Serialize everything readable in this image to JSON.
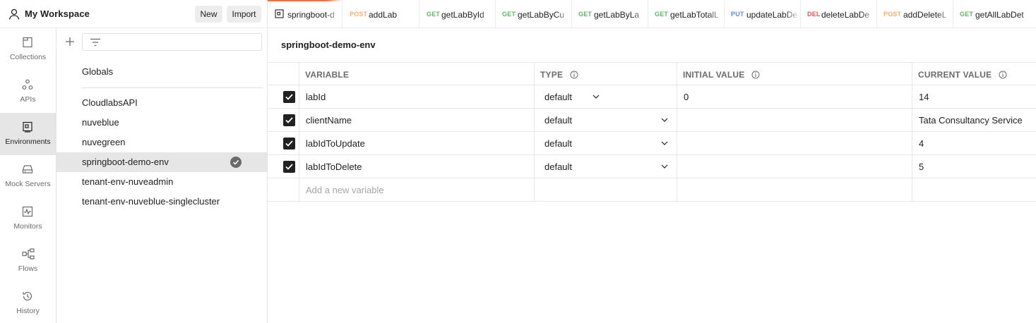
{
  "workspace": {
    "title": "My Workspace",
    "new_label": "New",
    "import_label": "Import"
  },
  "rail": [
    {
      "label": "Collections",
      "icon": "collections-icon"
    },
    {
      "label": "APIs",
      "icon": "apis-icon"
    },
    {
      "label": "Environments",
      "icon": "environments-icon",
      "active": true
    },
    {
      "label": "Mock Servers",
      "icon": "mock-servers-icon"
    },
    {
      "label": "Monitors",
      "icon": "monitors-icon"
    },
    {
      "label": "Flows",
      "icon": "flows-icon"
    },
    {
      "label": "History",
      "icon": "history-icon"
    }
  ],
  "env_list": {
    "globals": "Globals",
    "items": [
      {
        "label": "CloudlabsAPI"
      },
      {
        "label": "nuveblue"
      },
      {
        "label": "nuvegreen"
      },
      {
        "label": "springboot-demo-env",
        "active": true
      },
      {
        "label": "tenant-env-nuveadmin"
      },
      {
        "label": "tenant-env-nuveblue-singlecluster"
      }
    ]
  },
  "tabs": [
    {
      "method": "",
      "name": "springboot-d"
    },
    {
      "method": "POST",
      "name": "addLab"
    },
    {
      "method": "GET",
      "name": "getLabById"
    },
    {
      "method": "GET",
      "name": "getLabByCu"
    },
    {
      "method": "GET",
      "name": "getLabByLa"
    },
    {
      "method": "GET",
      "name": "getLabTotalL"
    },
    {
      "method": "PUT",
      "name": "updateLabDe"
    },
    {
      "method": "DEL",
      "name": "deleteLabDe"
    },
    {
      "method": "POST",
      "name": "addDeleteL"
    },
    {
      "method": "GET",
      "name": "getAllLabDet"
    }
  ],
  "environment": {
    "title": "springboot-demo-env",
    "headers": {
      "variable": "VARIABLE",
      "type": "TYPE",
      "initial": "INITIAL VALUE",
      "current": "CURRENT VALUE"
    },
    "rows": [
      {
        "variable": "labId",
        "type": "default",
        "initial": "0",
        "current": "14",
        "checked": true
      },
      {
        "variable": "clientName",
        "type": "default",
        "initial": "",
        "current": "Tata Consultancy Service",
        "checked": true
      },
      {
        "variable": "labIdToUpdate",
        "type": "default",
        "initial": "",
        "current": "4",
        "checked": true
      },
      {
        "variable": "labIdToDelete",
        "type": "default",
        "initial": "",
        "current": "5",
        "checked": true
      }
    ],
    "add_placeholder": "Add a new variable"
  },
  "colors": {
    "accent": "#ff6c37",
    "post": "#fdae6b",
    "get": "#5fb65f",
    "put": "#5e8ce6",
    "del": "#e5564d"
  }
}
